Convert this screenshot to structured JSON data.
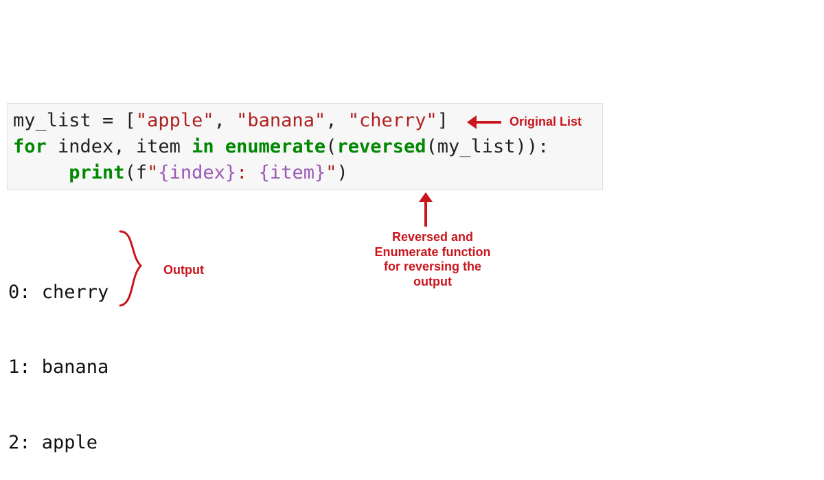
{
  "code": {
    "line1": {
      "var": "my_list",
      "eq": " = ",
      "lb": "[",
      "s1": "\"apple\"",
      "c1": ", ",
      "s2": "\"banana\"",
      "c2": ", ",
      "s3": "\"cherry\"",
      "rb": "]"
    },
    "blank": "",
    "line2": {
      "for": "for",
      "mid1": " index, item ",
      "in": "in",
      "sp": " ",
      "enum": "enumerate",
      "op1": "(",
      "rev": "reversed",
      "op2": "(my_list)):"
    },
    "line3": {
      "indent": "     ",
      "pr": "print",
      "op": "(",
      "fpre": "f",
      "fstr1": "\"",
      "fexp1": "{index}",
      "fcol": ": ",
      "fexp2": "{item}",
      "fstr2": "\"",
      "cp": ")"
    }
  },
  "output": {
    "l0": "0: cherry",
    "l1": "1: banana",
    "l2": "2: apple"
  },
  "annotations": {
    "original_list": "Original List",
    "output_label": "Output",
    "reversed_note_l1": "Reversed and",
    "reversed_note_l2": "Enumerate function",
    "reversed_note_l3": "for reversing the",
    "reversed_note_l4": "output"
  },
  "colors": {
    "anno": "#c9151d",
    "code_bg": "#f7f7f7",
    "str": "#b02121",
    "builtin": "#008800",
    "fexpr": "#9b59b6"
  }
}
